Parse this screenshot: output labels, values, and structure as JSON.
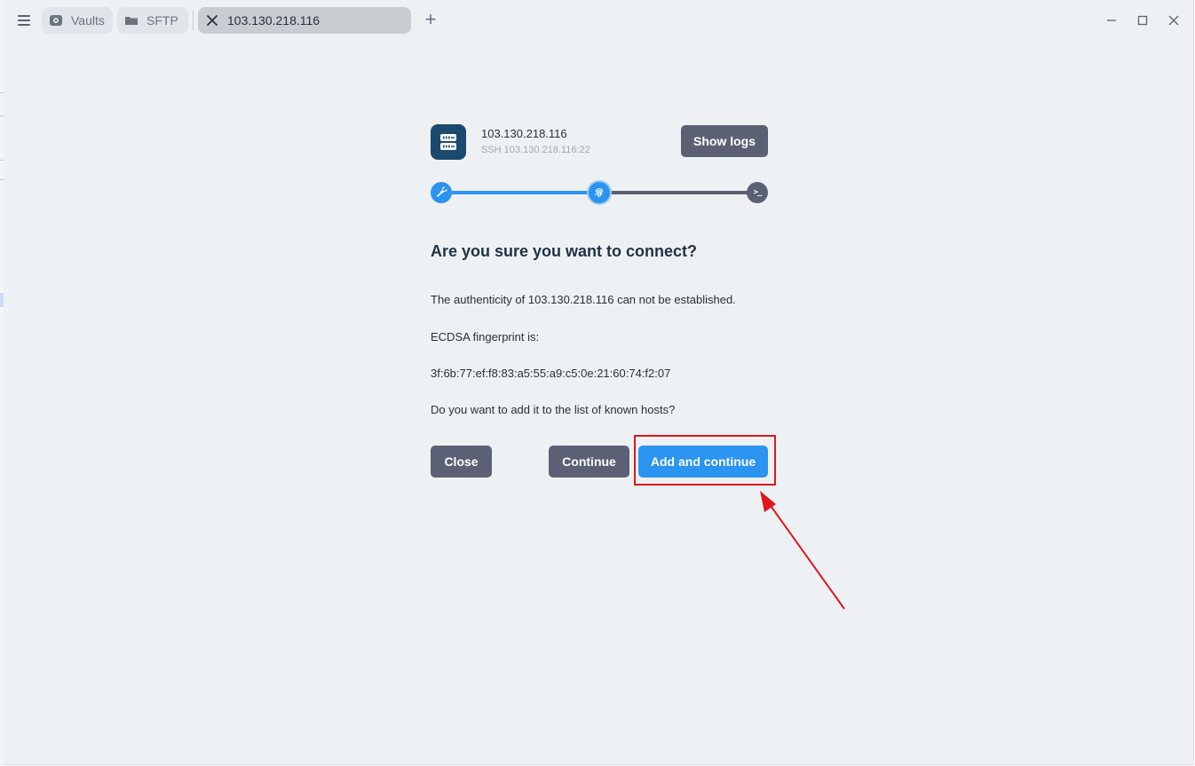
{
  "titlebar": {
    "tabs": [
      {
        "label": "Vaults",
        "icon": "vault-icon"
      },
      {
        "label": "SFTP",
        "icon": "folder-icon"
      },
      {
        "label": "103.130.218.116",
        "icon": "close-icon",
        "active": true
      }
    ],
    "new_tab_label": "+"
  },
  "host": {
    "name": "103.130.218.116",
    "subtitle": "SSH 103.130.218.116:22",
    "icon": "server-icon",
    "show_logs_label": "Show logs"
  },
  "progress": {
    "steps": [
      "plug-icon",
      "fingerprint-icon",
      "terminal-icon"
    ],
    "current_step": 2,
    "terminal_glyph": ">_"
  },
  "dialog": {
    "title": "Are you sure you want to connect?",
    "authenticity_text": "The authenticity of 103.130.218.116 can not be established.",
    "fingerprint_label": "ECDSA fingerprint is:",
    "fingerprint": "3f:6b:77:ef:f8:83:a5:55:a9:c5:0e:21:60:74:f2:07",
    "question": "Do you want to add it to the list of known hosts?",
    "close_label": "Close",
    "continue_label": "Continue",
    "add_continue_label": "Add and continue"
  },
  "colors": {
    "accent": "#2b93f0",
    "button_gray": "#5c6075",
    "annotation_red": "#e0161b"
  }
}
